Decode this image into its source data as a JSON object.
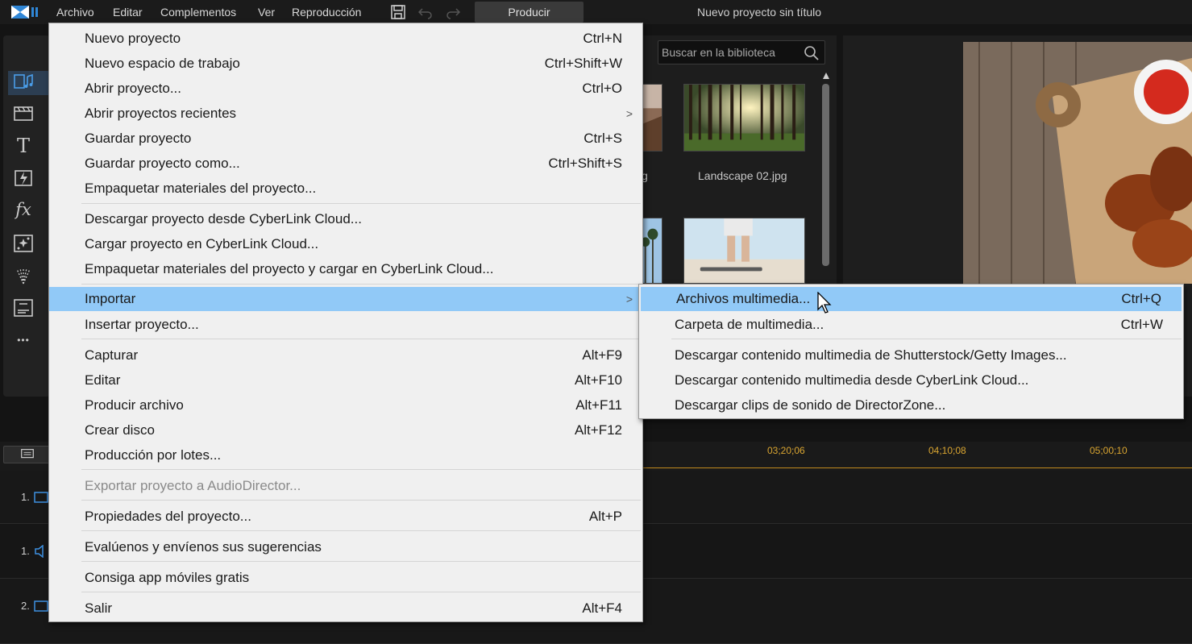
{
  "menubar": {
    "menus": [
      "Archivo",
      "Editar",
      "Complementos",
      "Ver",
      "Reproducción"
    ],
    "produce_label": "Producir",
    "project_title": "Nuevo proyecto sin título"
  },
  "left_toolbar": {
    "icons": [
      "media-room-icon",
      "film-icon",
      "title-icon",
      "transition-icon",
      "fx-icon",
      "particle-icon",
      "sparkle-icon",
      "subtitle-icon",
      "more-icon"
    ],
    "text_icon_glyph": "T",
    "fx_glyph": "fx",
    "more_glyph": "•••"
  },
  "library": {
    "search_placeholder": "Buscar en la biblioteca",
    "thumbnails": [
      {
        "caption": "Landscape 02.jpg"
      },
      {
        "caption": "g"
      }
    ]
  },
  "timeline": {
    "timecodes": [
      "03;20;06",
      "04;10;08",
      "05;00;10"
    ],
    "tracks": [
      {
        "num": "1."
      },
      {
        "num": "1."
      },
      {
        "num": "2."
      }
    ]
  },
  "file_menu": {
    "items": [
      {
        "label": "Nuevo proyecto",
        "shortcut": "Ctrl+N"
      },
      {
        "label": "Nuevo espacio de trabajo",
        "shortcut": "Ctrl+Shift+W"
      },
      {
        "label": "Abrir proyecto...",
        "shortcut": "Ctrl+O"
      },
      {
        "label": "Abrir proyectos recientes",
        "shortcut": "",
        "submenu": ">"
      },
      {
        "label": "Guardar proyecto",
        "shortcut": "Ctrl+S"
      },
      {
        "label": "Guardar proyecto como...",
        "shortcut": "Ctrl+Shift+S"
      },
      {
        "label": "Empaquetar materiales del proyecto...",
        "shortcut": ""
      },
      {
        "label": "Descargar proyecto desde CyberLink Cloud...",
        "shortcut": ""
      },
      {
        "label": "Cargar proyecto en CyberLink Cloud...",
        "shortcut": ""
      },
      {
        "label": "Empaquetar materiales del proyecto y cargar en CyberLink Cloud...",
        "shortcut": ""
      },
      {
        "label": "Importar",
        "shortcut": "",
        "submenu": ">"
      },
      {
        "label": "Insertar proyecto...",
        "shortcut": ""
      },
      {
        "label": "Capturar",
        "shortcut": "Alt+F9"
      },
      {
        "label": "Editar",
        "shortcut": "Alt+F10"
      },
      {
        "label": "Producir archivo",
        "shortcut": "Alt+F11"
      },
      {
        "label": "Crear disco",
        "shortcut": "Alt+F12"
      },
      {
        "label": "Producción por lotes...",
        "shortcut": ""
      },
      {
        "label": "Exportar proyecto a AudioDirector...",
        "shortcut": ""
      },
      {
        "label": "Propiedades del proyecto...",
        "shortcut": "Alt+P"
      },
      {
        "label": "Evalúenos y envíenos sus sugerencias",
        "shortcut": ""
      },
      {
        "label": "Consiga app móviles gratis",
        "shortcut": ""
      },
      {
        "label": "Salir",
        "shortcut": "Alt+F4"
      }
    ]
  },
  "import_submenu": {
    "items": [
      {
        "label": "Archivos multimedia...",
        "shortcut": "Ctrl+Q"
      },
      {
        "label": "Carpeta de multimedia...",
        "shortcut": "Ctrl+W"
      },
      {
        "label": "Descargar contenido multimedia de Shutterstock/Getty Images...",
        "shortcut": ""
      },
      {
        "label": "Descargar contenido multimedia desde CyberLink Cloud...",
        "shortcut": ""
      },
      {
        "label": "Descargar clips de sonido de DirectorZone...",
        "shortcut": ""
      }
    ]
  },
  "colors": {
    "menu_bg": "#f0f0f0",
    "highlight": "#91c9f7",
    "accent": "#3d8fe0",
    "timecode": "#d9a531"
  }
}
